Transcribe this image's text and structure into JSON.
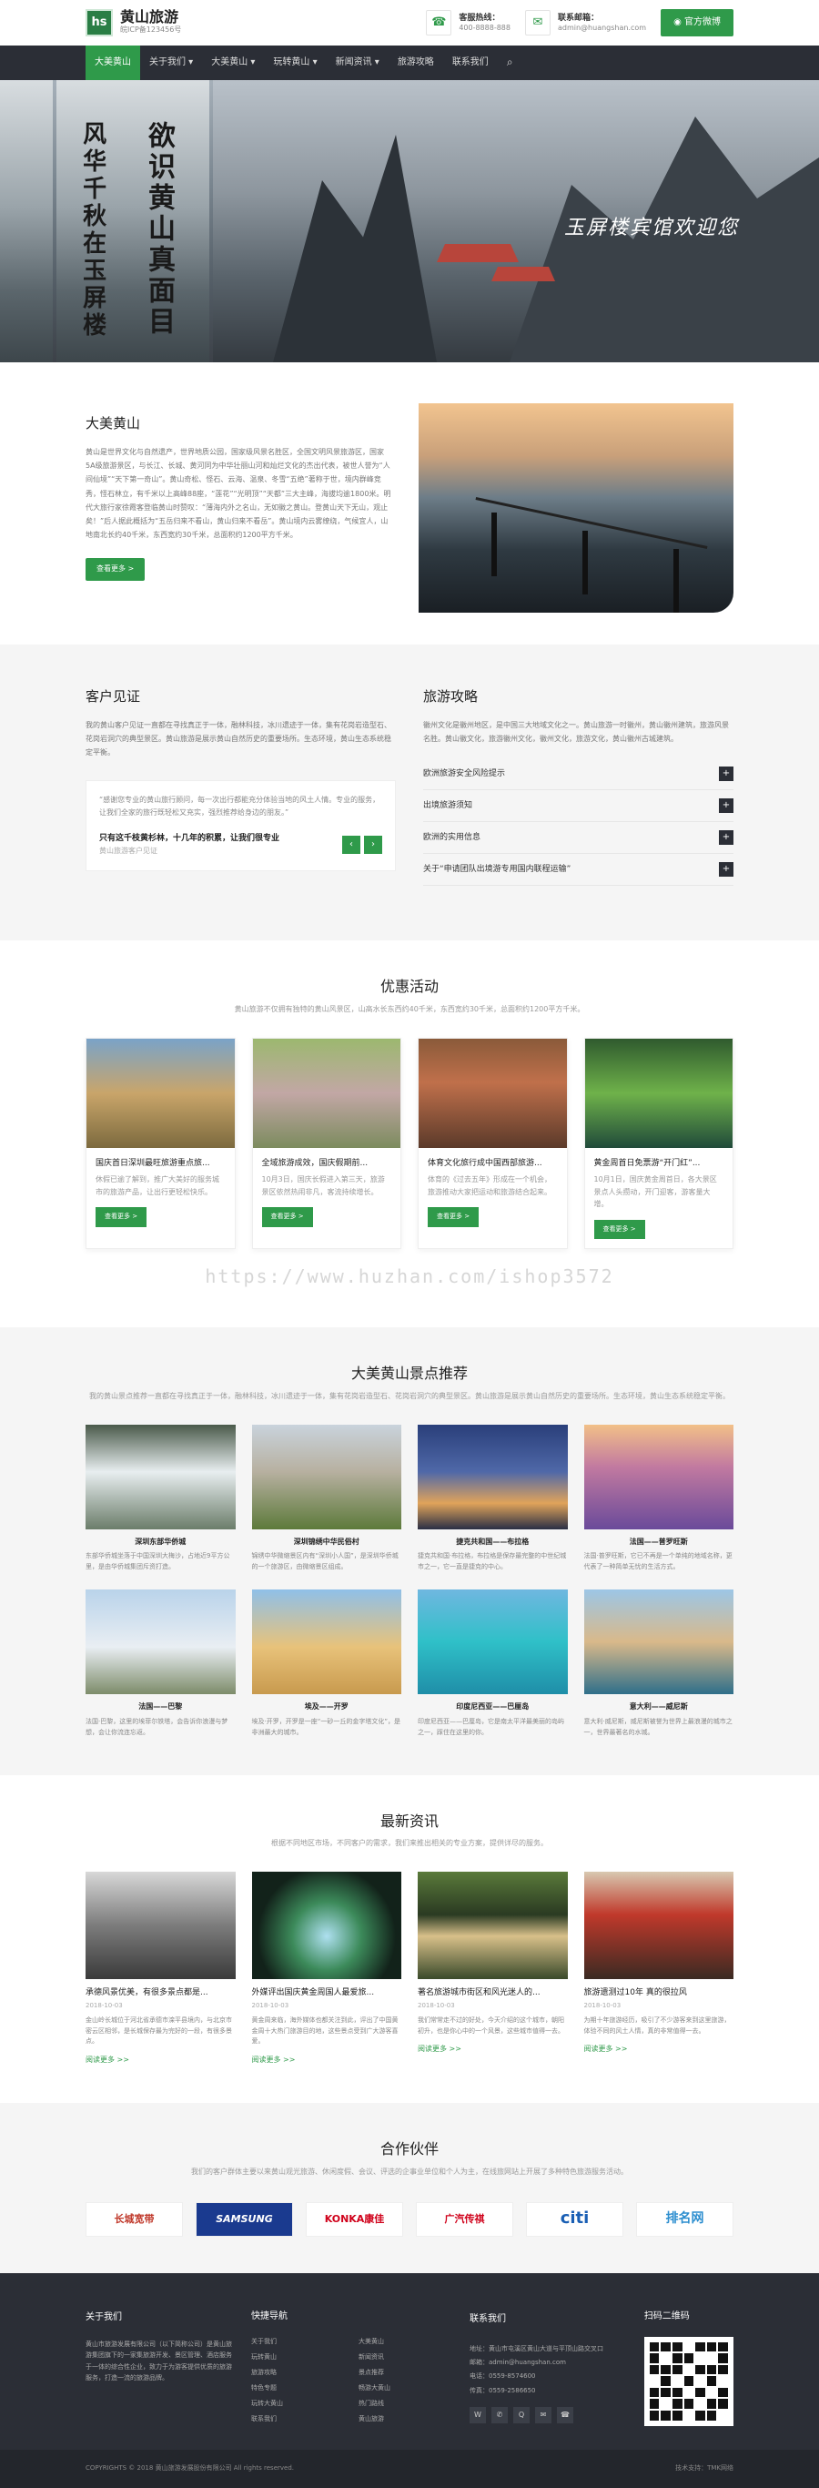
{
  "header": {
    "logo_mark": "hs",
    "logo_title": "黄山旅游",
    "logo_sub": "皖ICP备123456号",
    "phone_label": "客服热线：",
    "phone_value": "400-8888-888",
    "email_label": "联系邮箱：",
    "email_value": "admin@huangshan.com",
    "wx_button": "官方微博",
    "icons": {
      "phone": "phone-icon",
      "email": "mail-icon",
      "weibo": "weibo-icon"
    }
  },
  "nav": {
    "items": [
      "大美黄山",
      "关于我们 ▾",
      "大美黄山 ▾",
      "玩转黄山 ▾",
      "新闻资讯 ▾",
      "旅游攻略",
      "联系我们"
    ],
    "active_index": 0,
    "search_icon": "search-icon"
  },
  "banner": {
    "calli_1": "风华千秋在玉屏楼",
    "calli_2": "欲识黄山真面目",
    "caption": "玉屏楼宾馆欢迎您"
  },
  "about": {
    "title": "大美黄山",
    "text": "黄山是世界文化与自然遗产，世界地质公园，国家级风景名胜区，全国文明风景旅游区，国家5A级旅游景区，与长江、长城、黄河同为中华壮丽山河和灿烂文化的杰出代表，被世人誉为“人间仙境”“天下第一奇山”。黄山奇松、怪石、云海、温泉、冬雪“五绝”著称于世，境内群峰竞秀，怪石林立，有千米以上高峰88座，“莲花”“光明顶”“天都”三大主峰，海拔均逾1800米。明代大旅行家徐霞客登临黄山时赞叹：“薄海内外之名山，无如徽之黄山。登黄山天下无山，观止矣！”后人据此概括为“五岳归来不看山，黄山归来不看岳”。黄山境内云雾缭绕，气候宜人，山地南北长约40千米，东西宽约30千米，总面积约1200平方千米。",
    "button": "查看更多 >"
  },
  "testimonial": {
    "title": "客户见证",
    "intro": "我的黄山客户见证一直都在寻找真正于一体，融林科技，冰川遗迹于一体，集有花岗岩造型石、花岗岩洞穴的典型景区。黄山旅游是展示黄山自然历史的重要场所。生态环境，黄山生态系统稳定平衡。",
    "quote": "“感谢您专业的黄山旅行顾问，每一次出行都能充分体验当地的风土人情。专业的服务，让我们全家的旅行既轻松又充实，强烈推荐给身边的朋友。”",
    "author": "只有这千枝黄杉林，十几年的积累，让我们很专业",
    "author_sub": "黄山旅游客户见证",
    "prev": "‹",
    "next": "›"
  },
  "travel": {
    "title": "旅游攻略",
    "intro": "徽州文化是徽州地区，是中国三大地域文化之一。黄山旅游一时徽州，黄山徽州建筑，旅游风景名胜。黄山徽文化，旅游徽州文化，徽州文化，旅游文化，黄山徽州古城建筑。",
    "items": [
      "欧洲旅游安全风险提示",
      "出境旅游须知",
      "欧洲的实用信息",
      "关于“申请团队出境游专用国内联程运输”"
    ],
    "plus": "+"
  },
  "promos": {
    "title": "优惠活动",
    "sub": "黄山旅游不仅拥有独特的黄山风景区，山高水长东西约40千米，东西宽约30千米，总面积约1200平方千米。",
    "cards": [
      {
        "title": "国庆首日深圳最旺旅游重点旅...",
        "desc": "休假已逾了解到，推广大美好的服务城市的旅游产品，让出行更轻松快乐。",
        "btn": "查看更多 >"
      },
      {
        "title": "全域旅游成效，国庆假期前...",
        "desc": "10月3日，国庆长假进入第三天，旅游景区依然热闹非凡，客流持续增长。",
        "btn": "查看更多 >"
      },
      {
        "title": "体育文化旅行成中国西部旅游...",
        "desc": "体育的《过去五年》形成在一个机会，旅游推动大家把运动和旅游结合起来。",
        "btn": "查看更多 >"
      },
      {
        "title": "黄金周首日免票游“开门红”...",
        "desc": "10月1日，国庆黄金周首日，各大景区景点人头攒动，开门迎客，游客量大增。",
        "btn": "查看更多 >"
      }
    ]
  },
  "watermark": "https://www.huzhan.com/ishop3572",
  "spots": {
    "title": "大美黄山景点推荐",
    "sub": "我的黄山景点推荐一直都在寻找真正于一体，融林科技，冰川遗迹于一体，集有花岗岩造型石、花岗岩洞穴的典型景区。黄山旅游是展示黄山自然历史的重要场所。生态环境，黄山生态系统稳定平衡。",
    "items": [
      {
        "title": "深圳东部华侨城",
        "desc": "东部华侨城坐落于中国深圳大梅沙，占地近9平方公里，是由华侨城集团斥资打造。"
      },
      {
        "title": "深圳锦绣中华民俗村",
        "desc": "锦绣中华微缩景区内有“深圳小人国”，是深圳华侨城的一个旅游区，由微缩景区组成。"
      },
      {
        "title": "捷克共和国——布拉格",
        "desc": "捷克共和国·布拉格，布拉格是保存最完整的中世纪城市之一，它一直是捷克的中心。"
      },
      {
        "title": "法国——普罗旺斯",
        "desc": "法国·普罗旺斯，它已不再是一个单纯的地域名称，更代表了一种简单无忧的生活方式。"
      },
      {
        "title": "法国——巴黎",
        "desc": "法国·巴黎，这里的埃菲尔铁塔，会告诉你浪漫与梦想，会让你流连忘返。"
      },
      {
        "title": "埃及——开罗",
        "desc": "埃及·开罗，开罗是一座“一砂一丘的金字塔文化”，是非洲最大的城市。"
      },
      {
        "title": "印度尼西亚——巴厘岛",
        "desc": "印度尼西亚——巴厘岛，它是南太平洋最美丽的岛屿之一，踩住在这里的你。"
      },
      {
        "title": "意大利——威尼斯",
        "desc": "意大利·威尼斯，威尼斯被誉为世界上最浪漫的城市之一，世界最著名的水城。"
      }
    ]
  },
  "news": {
    "title": "最新资讯",
    "sub": "根据不同地区市场，不同客户的需求，我们来推出相关的专业方案，提供详尽的服务。",
    "items": [
      {
        "title": "承德风景优美，有很多景点都是...",
        "date": "2018-10-03",
        "desc": "金山岭长城位于河北省承德市滦平县境内，与北京市密云区相邻，是长城保存最为完好的一段，有很多景点。",
        "more": "阅读更多 >>"
      },
      {
        "title": "外媒评出国庆黄金周国人最爱旅...",
        "date": "2018-10-03",
        "desc": "黄金周来临，海外媒体也都关注到此，评出了中国黄金周十大热门旅游目的地，这些景点受到广大游客喜爱。",
        "more": "阅读更多 >>"
      },
      {
        "title": "著名旅游城市街区和风光迷人的...",
        "date": "2018-10-03",
        "desc": "我们常常走不过的好处，今天介绍的这个城市，朝阳初升，也是你心中的一个风景，这些城市值得一去。",
        "more": "阅读更多 >>"
      },
      {
        "title": "旅游遗测过10年 真的很拉风",
        "date": "2018-10-03",
        "desc": "为期十年旅游经历，吸引了不少游客来到这里旅游，体验不同的风土人情，真的非常值得一去。",
        "more": "阅读更多 >>"
      }
    ]
  },
  "partners": {
    "title": "合作伙伴",
    "sub": "我们的客户群体主要以来黄山观光旅游、休闲度假、会议、评选的企事业单位和个人为主，在线旅网站上开展了多种特色旅游服务活动。",
    "logos": [
      "长城宽带",
      "SAMSUNG",
      "KONKA康佳",
      "广汽传祺",
      "citi",
      "排名网"
    ],
    "logo_colors": [
      "#c0392b",
      "#1a3a8f",
      "#d0021b",
      "#d0021b",
      "#1a5fb4",
      "#2c8ecf"
    ]
  },
  "footer": {
    "about_title": "关于我们",
    "about_text": "黄山市旅游发展有限公司（以下简称公司）是黄山旅游集团旗下的一家集旅游开发、景区管理、酒店服务于一体的综合性企业，致力于为游客提供优质的旅游服务，打造一流的旅游品牌。",
    "links_title": "快捷导航",
    "links": [
      "关于我们",
      "大美黄山",
      "玩转黄山",
      "新闻资讯",
      "旅游攻略",
      "景点推荐",
      "特色专题",
      "畅游大黄山",
      "玩转大黄山",
      "热门路线",
      "联系我们",
      "黄山旅游"
    ],
    "contact_title": "联系我们",
    "contact": [
      "地址：黄山市屯溪区黄山大道与平顶山路交叉口",
      "邮箱：admin@huangshan.com",
      "电话：0559-8574600",
      "传真：0559-2586650"
    ],
    "socials": [
      "weibo-icon",
      "wechat-icon",
      "qq-icon",
      "mail-icon",
      "phone-icon"
    ],
    "qr_title": "扫码二维码"
  },
  "copyright": {
    "left": "COPYRIGHTS © 2018 黄山旅游发展股份有限公司 All rights reserved.",
    "right": "技术支持：TMK网络"
  }
}
